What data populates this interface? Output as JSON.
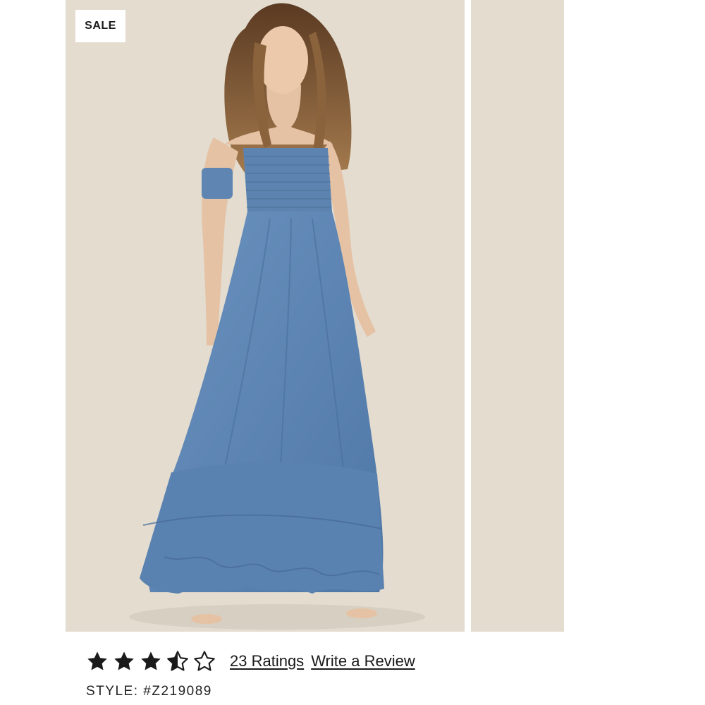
{
  "product": {
    "badge": "SALE",
    "photo_alt": "",
    "rating": {
      "value": 3.5,
      "max": 5,
      "count_label": "23 Ratings",
      "write_review_label": "Write a Review"
    },
    "style_label": "STYLE:",
    "style_code": "#Z219089"
  },
  "colors": {
    "photo_background": "#e3dccf",
    "dress": "#5f86b3",
    "star_fill": "#1a1a1a"
  },
  "icons": {
    "star_full": "star-full-icon",
    "star_half": "star-half-icon",
    "star_empty": "star-empty-icon"
  }
}
